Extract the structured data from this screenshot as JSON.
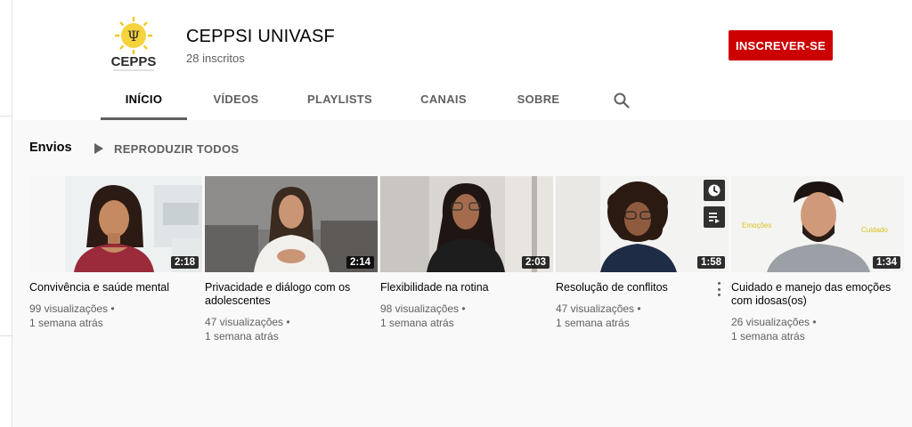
{
  "channel": {
    "name": "CEPPSI UNIVASF",
    "subscribers": "28 inscritos",
    "logo_text": "CEPPS",
    "subscribe_label": "INSCREVER-SE"
  },
  "tabs": [
    {
      "label": "INÍCIO",
      "active": true
    },
    {
      "label": "VÍDEOS"
    },
    {
      "label": "PLAYLISTS"
    },
    {
      "label": "CANAIS"
    },
    {
      "label": "SOBRE"
    }
  ],
  "section": {
    "title": "Envios",
    "play_all_label": "REPRODUZIR TODOS"
  },
  "videos": [
    {
      "title": "Convivência e saúde mental",
      "views": "99 visualizações •",
      "age": "1 semana atrás",
      "duration": "2:18"
    },
    {
      "title": "Privacidade e diálogo com os adolescentes",
      "views": "47 visualizações •",
      "age": "1 semana atrás",
      "duration": "2:14"
    },
    {
      "title": "Flexibilidade na rotina",
      "views": "98 visualizações •",
      "age": "1 semana atrás",
      "duration": "2:03"
    },
    {
      "title": "Resolução de conflitos",
      "views": "47 visualizações •",
      "age": "1 semana atrás",
      "duration": "1:58"
    },
    {
      "title": "Cuidado e manejo das emoções com idosas(os)",
      "views": "26 visualizações •",
      "age": "1 semana atrás",
      "duration": "1:34",
      "overlay_left": "Emoções",
      "overlay_right": "Cuidado"
    }
  ],
  "colors": {
    "subscribe": "#cc0000",
    "background": "#f9f9f9",
    "header": "#ffffff",
    "secondary_text": "#606060"
  },
  "icons": [
    "search-icon",
    "play-icon",
    "watch-later-icon",
    "add-to-queue-icon",
    "more-vert-icon"
  ]
}
